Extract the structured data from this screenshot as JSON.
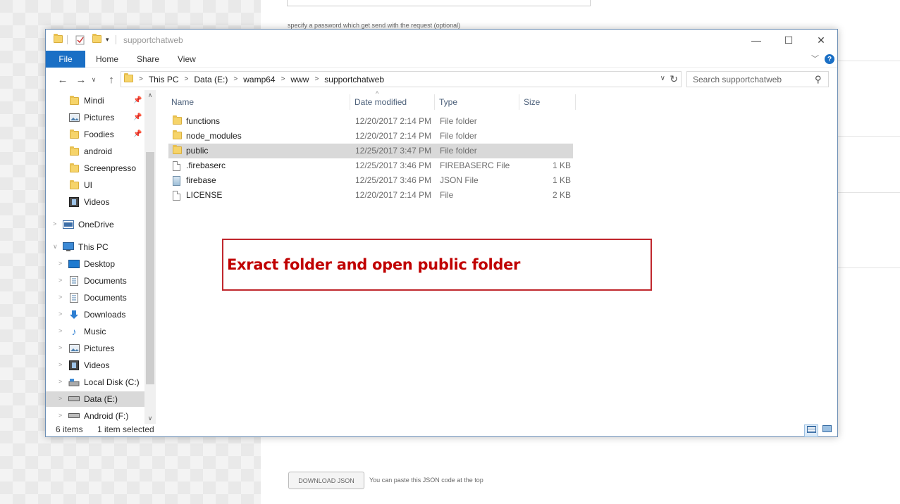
{
  "background_page": {
    "password_hint": "specify a password which get send with the request (optional)",
    "download_button": "DOWNLOAD JSON",
    "download_note": "You can paste this JSON code at the top"
  },
  "window": {
    "title": "supportchatweb",
    "controls": {
      "minimize": "—",
      "maximize": "☐",
      "close": "✕"
    }
  },
  "ribbon": {
    "file_tab": "File",
    "tabs": [
      "Home",
      "Share",
      "View"
    ],
    "help": "?"
  },
  "address": {
    "breadcrumb": [
      "This PC",
      "Data (E:)",
      "wamp64",
      "www",
      "supportchatweb"
    ],
    "search_placeholder": "Search supportchatweb"
  },
  "nav_pane": {
    "quick_access": [
      {
        "label": "Mindi",
        "icon": "folder-icon",
        "pinned": true
      },
      {
        "label": "Pictures",
        "icon": "pictures-icon",
        "pinned": true
      },
      {
        "label": "Foodies",
        "icon": "folder-icon",
        "pinned": true
      },
      {
        "label": "android",
        "icon": "folder-icon",
        "pinned": false
      },
      {
        "label": "Screenpresso",
        "icon": "folder-icon",
        "pinned": false
      },
      {
        "label": "UI",
        "icon": "folder-icon",
        "pinned": false
      },
      {
        "label": "Videos",
        "icon": "videos-icon",
        "pinned": false
      }
    ],
    "onedrive": "OneDrive",
    "this_pc": "This PC",
    "this_pc_items": [
      {
        "label": "Desktop",
        "icon": "desktop-icon"
      },
      {
        "label": "Documents",
        "icon": "documents-icon"
      },
      {
        "label": "Documents",
        "icon": "documents-icon"
      },
      {
        "label": "Downloads",
        "icon": "downloads-icon"
      },
      {
        "label": "Music",
        "icon": "music-icon"
      },
      {
        "label": "Pictures",
        "icon": "pictures-icon"
      },
      {
        "label": "Videos",
        "icon": "videos-icon"
      },
      {
        "label": "Local Disk (C:)",
        "icon": "local-disk-icon"
      },
      {
        "label": "Data (E:)",
        "icon": "drive-icon",
        "selected": true
      },
      {
        "label": "Android (F:)",
        "icon": "drive-icon"
      }
    ]
  },
  "columns": {
    "name": "Name",
    "date": "Date modified",
    "type": "Type",
    "size": "Size"
  },
  "files": [
    {
      "name": "functions",
      "date": "12/20/2017 2:14 PM",
      "type": "File folder",
      "size": "",
      "icon": "folder-icon"
    },
    {
      "name": "node_modules",
      "date": "12/20/2017 2:14 PM",
      "type": "File folder",
      "size": "",
      "icon": "folder-icon"
    },
    {
      "name": "public",
      "date": "12/25/2017 3:47 PM",
      "type": "File folder",
      "size": "",
      "icon": "folder-icon",
      "selected": true
    },
    {
      "name": ".firebaserc",
      "date": "12/25/2017 3:46 PM",
      "type": "FIREBASERC File",
      "size": "1 KB",
      "icon": "file-icon"
    },
    {
      "name": "firebase",
      "date": "12/25/2017 3:46 PM",
      "type": "JSON File",
      "size": "1 KB",
      "icon": "json-file-icon"
    },
    {
      "name": "LICENSE",
      "date": "12/20/2017 2:14 PM",
      "type": "File",
      "size": "2 KB",
      "icon": "file-icon"
    }
  ],
  "annotation": {
    "text": "Exract folder and open public folder",
    "color": "#c00000"
  },
  "status": {
    "items": "6 items",
    "selected": "1 item selected"
  },
  "colors": {
    "accent": "#1a6fc5",
    "selection": "#d9d9d9"
  }
}
